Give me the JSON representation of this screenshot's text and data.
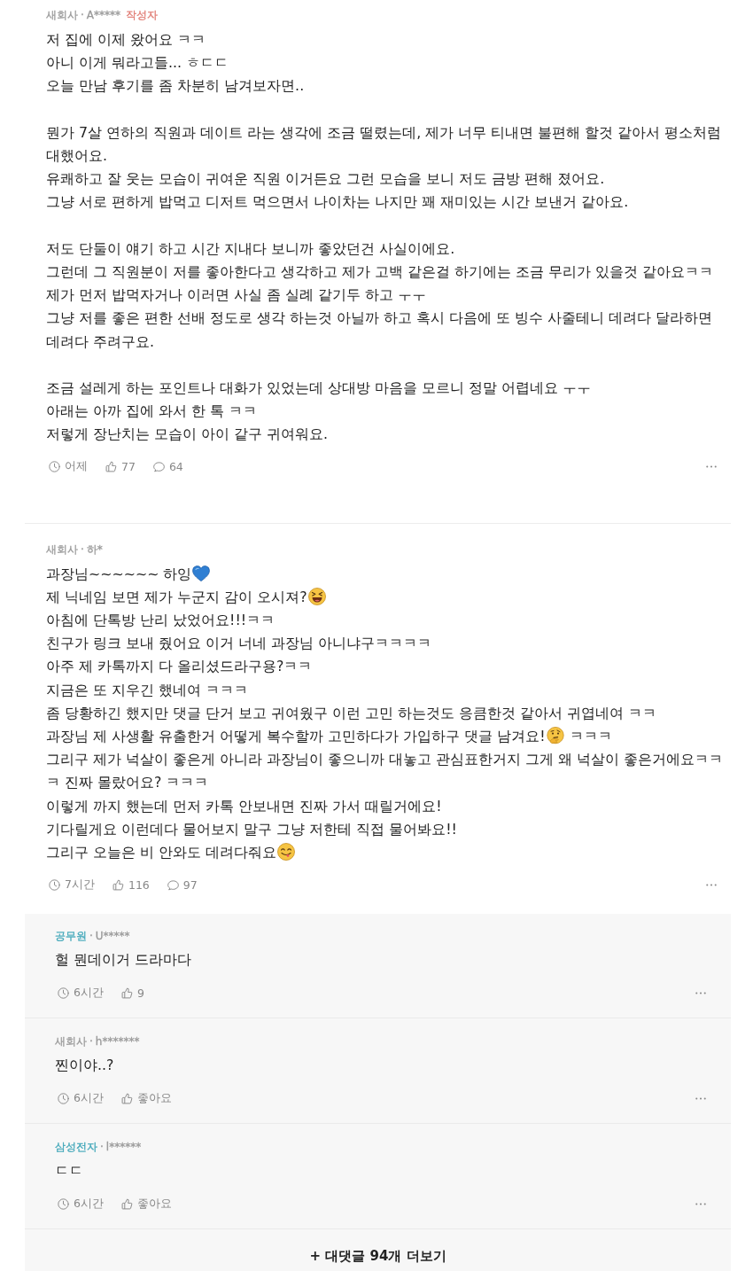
{
  "comments": [
    {
      "author": {
        "company": "새회사",
        "color": "#9a9a9a",
        "separator": "·",
        "user": "A*****",
        "badge": "작성자"
      },
      "paragraphs": [
        [
          "저 집에 이제 왔어요 ㅋㅋ",
          "아니 이게 뭐라고들... ㅎㄷㄷ",
          "오늘 만남 후기를 좀 차분히 남겨보자면.."
        ],
        [
          "뭔가 7살 연하의 직원과 데이트 라는 생각에 조금 떨렸는데, 제가 너무 티내면 불편해 할것 같아서 평소처럼 대했어요.",
          "유쾌하고 잘 웃는 모습이 귀여운 직원 이거든요 그런 모습을 보니 저도 금방 편해 졌어요.",
          "그냥 서로 편하게 밥먹고 디저트 먹으면서 나이차는 나지만 꽤 재미있는 시간 보낸거 같아요."
        ],
        [
          "저도 단둘이 얘기 하고 시간 지내다 보니까 좋았던건 사실이에요.",
          "그런데 그 직원분이 저를 좋아한다고 생각하고 제가 고백 같은걸 하기에는 조금 무리가 있을것 같아요ㅋㅋ",
          "제가 먼저 밥먹자거나 이러면 사실 좀 실례 같기두 하고 ㅜㅜ",
          "그냥 저를 좋은 편한 선배 정도로 생각 하는것 아닐까 하고 혹시 다음에 또 빙수 사줄테니 데려다 달라하면 데려다 주려구요."
        ],
        [
          "조금 설레게 하는 포인트나 대화가 있었는데 상대방 마음을 모르니 정말 어렵네요 ㅜㅜ",
          "아래는 아까 집에 와서 한 톡 ㅋㅋ",
          "저렇게 장난치는 모습이 아이 같구 귀여워요."
        ]
      ],
      "time": "어제",
      "likes": "77",
      "comment_count": "64"
    },
    {
      "author": {
        "company": "새회사",
        "color": "#9a9a9a",
        "separator": "·",
        "user": "하*"
      },
      "paragraphs": [
        [
          {
            "kind": "heart",
            "text": "과장님~~~~~~ 하잉"
          },
          {
            "kind": "laughing",
            "text": "제 닉네임 보면 제가 누군지 감이 오시져?"
          },
          "아침에 단톡방 난리 났었어요!!!ㅋㅋ",
          "친구가 링크 보내 줬어요 이거 너네 과장님 아니냐구ㅋㅋㅋㅋ",
          "아주 제 카톡까지 다 올리셨드라구용?ㅋㅋ",
          "지금은 또 지우긴 했네여 ㅋㅋㅋ",
          "좀 당황하긴 했지만 댓글 단거 보고 귀여웠구 이런 고민 하는것도 응큼한것 같아서 귀엽네여 ㅋㅋ",
          {
            "kind": "thinking",
            "text": "과장님 제 사생활 유출한거 어떻게 복수할까 고민하다가 가입하구 댓글 남겨요!",
            "after": "ㅋㅋㅋ"
          },
          "그리구 제가 넉살이 좋은게 아니라 과장님이 좋으니까 대놓고 관심표한거지 그게 왜 넉살이 좋은거에요ㅋㅋㅋ 진짜 몰랐어요? ㅋㅋㅋ",
          "이렇게 까지 했는데 먼저 카톡 안보내면 진짜 가서 때릴거에요!",
          "기다릴게요 이런데다 물어보지 말구 그냥 저한테 직접 물어봐요!!",
          {
            "kind": "yum",
            "text": "그리구 오늘은 비 안와도 데려다줘요"
          }
        ]
      ],
      "time": "7시간",
      "likes": "116",
      "comment_count": "97",
      "replies": [
        {
          "author": {
            "company": "공무원",
            "color": "#3fa6b8",
            "separator": "·",
            "user": "U*****"
          },
          "paragraphs": [
            [
              "헐 뭔데이거 드라마다"
            ]
          ],
          "time": "6시간",
          "likes": "9"
        },
        {
          "author": {
            "company": "새회사",
            "color": "#9a9a9a",
            "separator": "·",
            "user": "h*******"
          },
          "paragraphs": [
            [
              "찐이야..?"
            ]
          ],
          "time": "6시간",
          "likes": "좋아요"
        },
        {
          "author": {
            "company": "삼성전자",
            "color": "#3fa6b8",
            "separator": "·",
            "user": "l******"
          },
          "paragraphs": [
            [
              "ㄷㄷ"
            ]
          ],
          "time": "6시간",
          "likes": "좋아요"
        }
      ],
      "more_replies": "+ 대댓글 94개 더보기"
    }
  ]
}
